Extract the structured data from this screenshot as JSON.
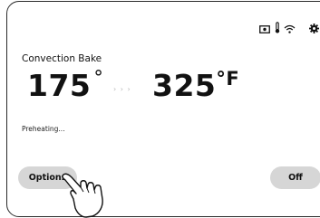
{
  "status_bar": {
    "icons": [
      "camera-icon",
      "thermometer-icon",
      "wifi-icon",
      "gear-icon"
    ]
  },
  "oven": {
    "mode": "Convection Bake",
    "current_temp": "175",
    "current_symbol": "°",
    "target_temp": "325",
    "target_symbol": "°F",
    "progress_arrow": "› › ›",
    "status": "Preheating..."
  },
  "buttons": {
    "options_label": "Options",
    "off_label": "Off"
  },
  "colors": {
    "button_bg": "#d6d6d6",
    "arrow": "#b8b8b8",
    "frame": "#2a2a2a"
  },
  "overlay": {
    "icon": "pointing-hand-icon"
  }
}
